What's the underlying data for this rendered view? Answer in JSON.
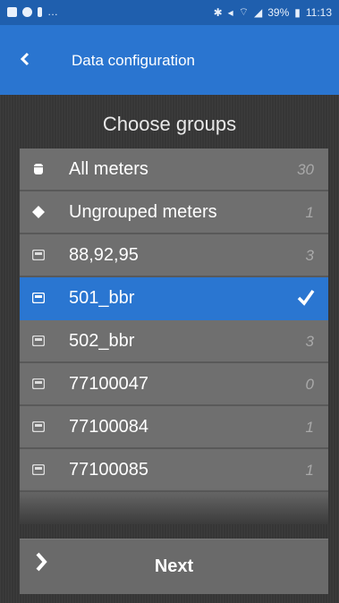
{
  "status_bar": {
    "left_text": "…",
    "battery": "39%",
    "time": "11:13"
  },
  "app_bar": {
    "back_icon": "chevron-left-icon",
    "title": "Data configuration"
  },
  "main": {
    "heading": "Choose groups",
    "items": [
      {
        "icon": "database-icon",
        "label": "All meters",
        "count": "30",
        "selected": false
      },
      {
        "icon": "diamond-icon",
        "label": "Ungrouped meters",
        "count": "1",
        "selected": false
      },
      {
        "icon": "meter-icon",
        "label": "88,92,95",
        "count": "3",
        "selected": false
      },
      {
        "icon": "meter-icon",
        "label": "501_bbr",
        "count": "",
        "selected": true
      },
      {
        "icon": "meter-icon",
        "label": "502_bbr",
        "count": "3",
        "selected": false
      },
      {
        "icon": "meter-icon",
        "label": "77100047",
        "count": "0",
        "selected": false
      },
      {
        "icon": "meter-icon",
        "label": "77100084",
        "count": "1",
        "selected": false
      },
      {
        "icon": "meter-icon",
        "label": "77100085",
        "count": "1",
        "selected": false
      }
    ],
    "next_label": "Next"
  },
  "colors": {
    "status_bar": "#1f5fae",
    "app_bar": "#2a75d0",
    "selected": "#2a76d1",
    "background": "#363636",
    "item": "#6f6f6f"
  }
}
